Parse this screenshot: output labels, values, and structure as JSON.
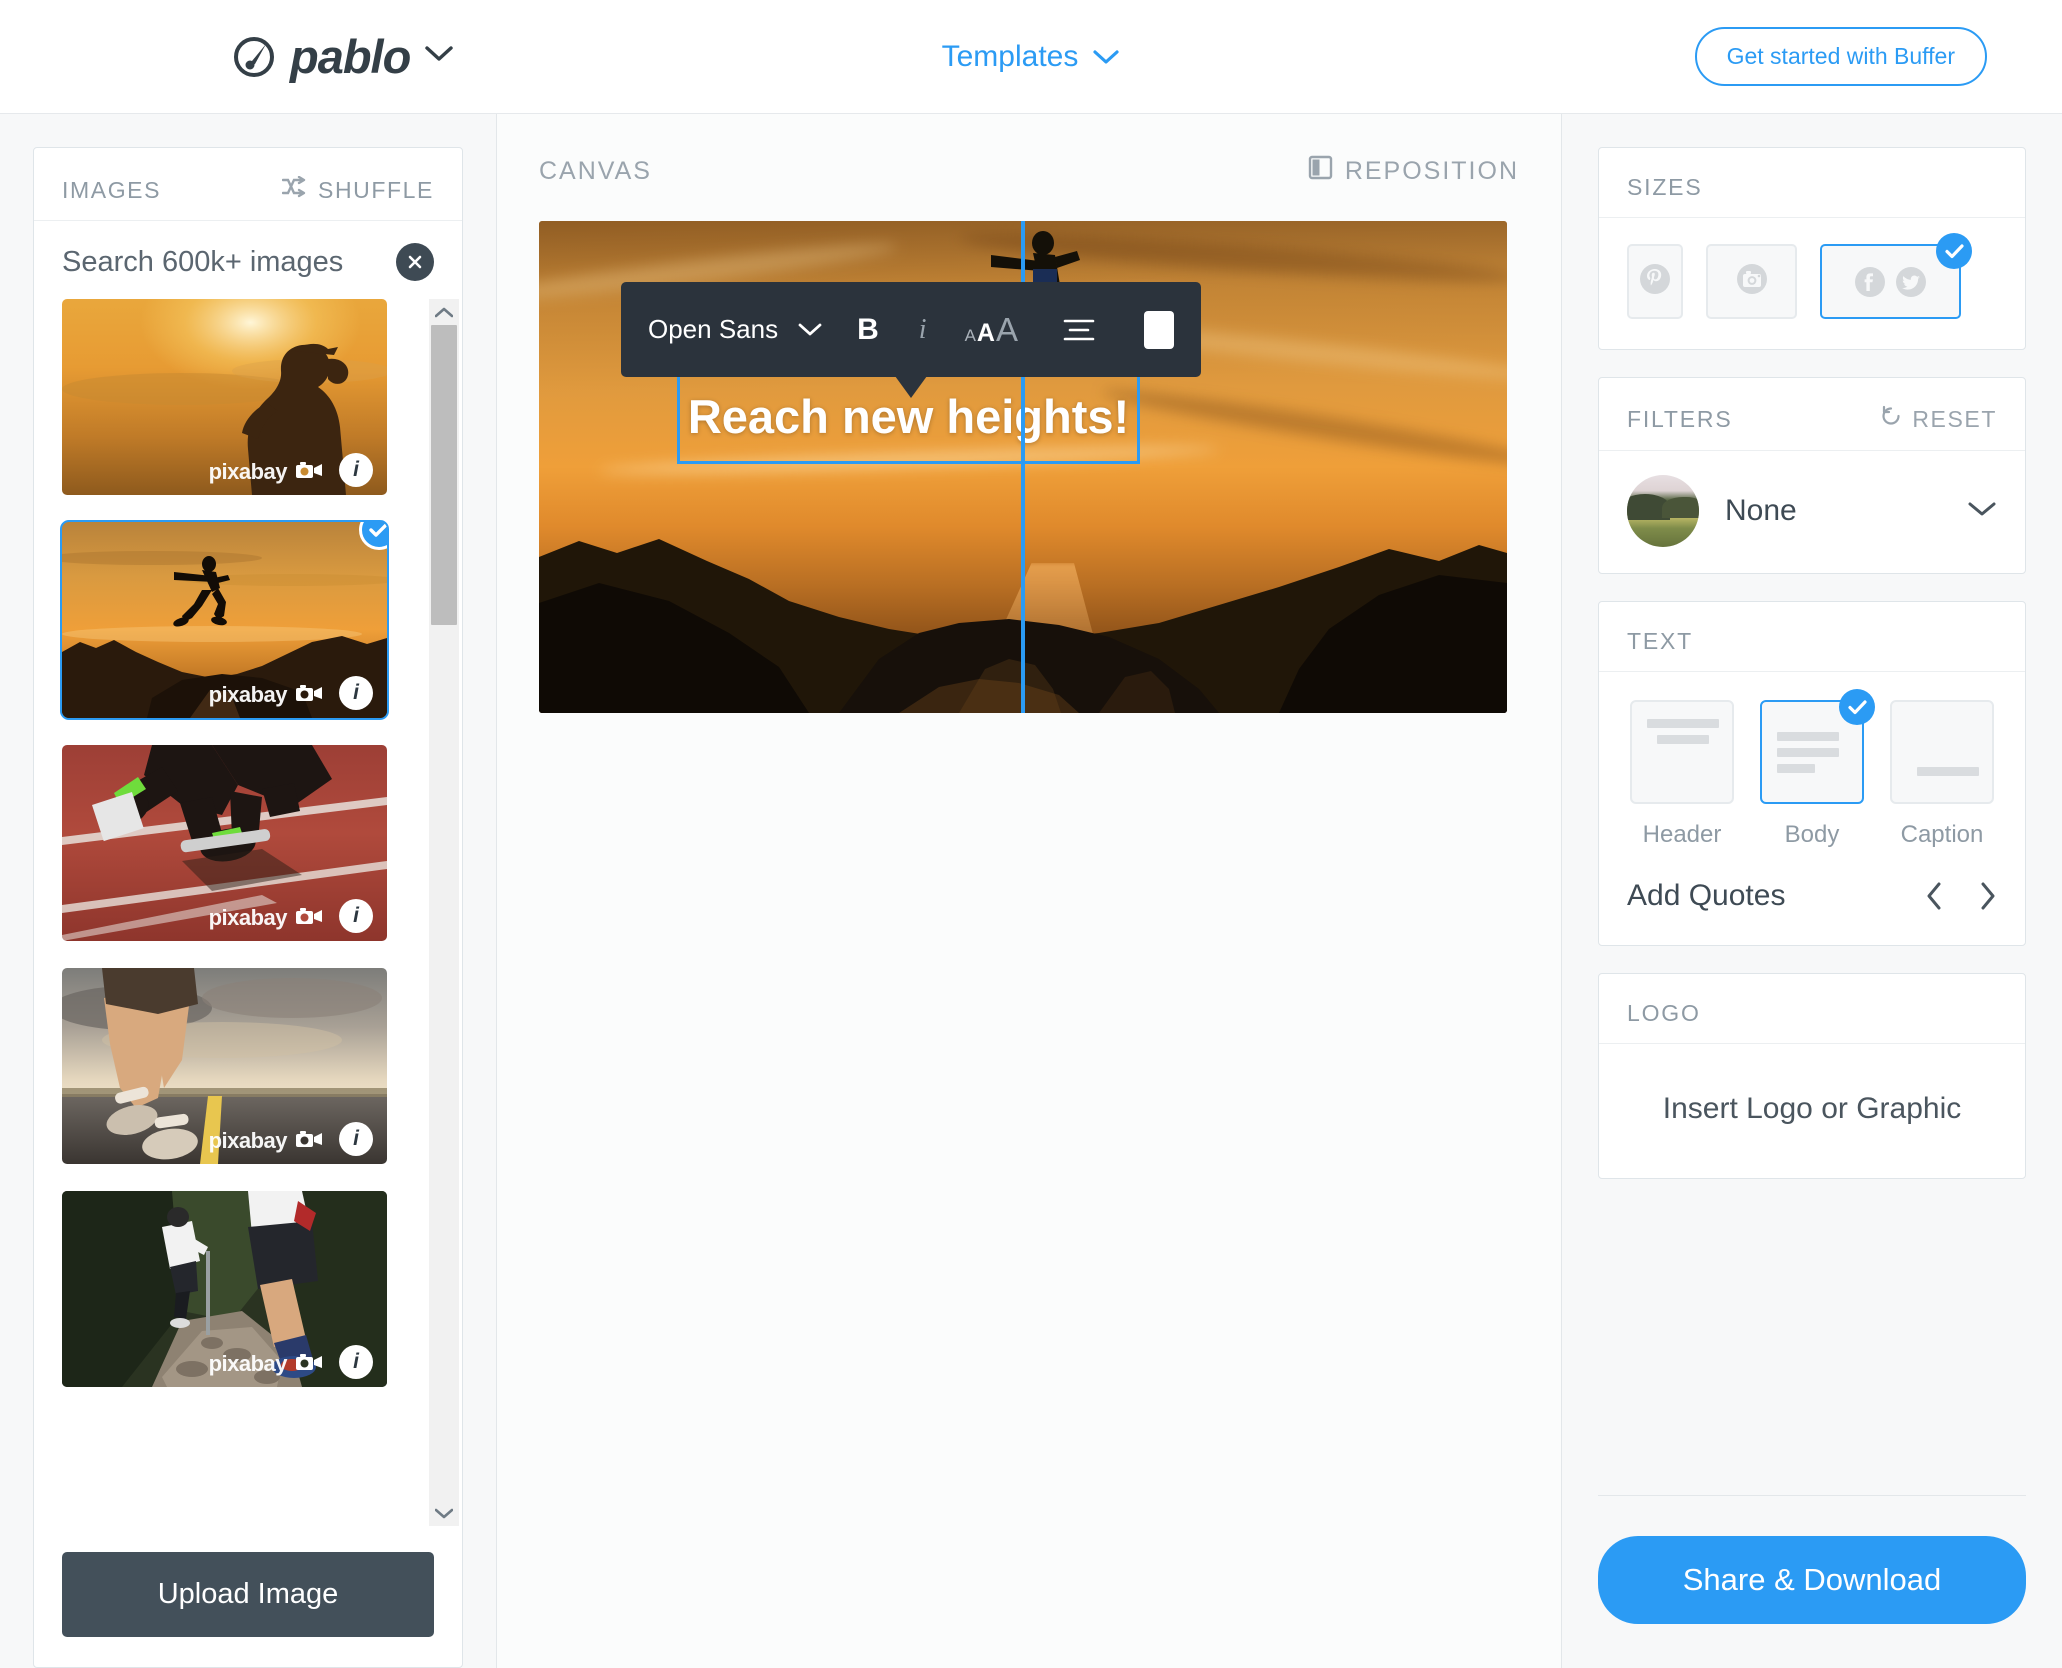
{
  "header": {
    "brand": "pablo",
    "brand_icon": "pablo-brush-circle-icon",
    "brand_chevron": "chevron-down-icon",
    "templates_label": "Templates",
    "templates_chevron": "chevron-down-icon",
    "buffer_button": "Get started with Buffer",
    "accent_blue": "#2b9bf4"
  },
  "images_panel": {
    "title": "IMAGES",
    "shuffle_label": "SHUFFLE",
    "shuffle_icon": "shuffle-icon",
    "search_value": "Search 600k+ images",
    "search_placeholder": "Search 600k+ images",
    "clear_icon": "close-icon",
    "upload_button": "Upload Image",
    "thumbnails": [
      {
        "alt": "Woman running at sunset silhouette",
        "watermark": "pixabay",
        "info": "i",
        "selected": false
      },
      {
        "alt": "Runner leaping over rocky gorge at sunset",
        "watermark": "pixabay",
        "info": "i",
        "selected": true
      },
      {
        "alt": "Sprinter in starting blocks on red track",
        "watermark": "pixabay",
        "info": "i",
        "selected": false
      },
      {
        "alt": "Runner legs on road with yellow line",
        "watermark": "pixabay",
        "info": "i",
        "selected": false
      },
      {
        "alt": "Trail runners on forest path",
        "watermark": "pixabay",
        "info": "i",
        "selected": false
      }
    ]
  },
  "canvas_panel": {
    "title": "CANVAS",
    "reposition_label": "REPOSITION",
    "reposition_icon": "reposition-icon",
    "canvas_text": "Reach new heights!",
    "image_alt": "Runner leaping over rocky gorge at sunset",
    "toolbar": {
      "font_name": "Open Sans",
      "font_chevron": "chevron-down-icon",
      "bold_label": "B",
      "bold_active": true,
      "italic_label": "i",
      "italic_active": false,
      "size_small": "A",
      "size_medium": "A",
      "size_large": "A",
      "align_icon": "align-center-icon",
      "color_swatch": "#ffffff"
    }
  },
  "sizes_panel": {
    "title": "SIZES",
    "options": [
      {
        "name": "Pinterest",
        "icon": "pinterest-icon",
        "selected": false
      },
      {
        "name": "Instagram",
        "icon": "instagram-icon",
        "selected": false
      },
      {
        "name": "Facebook & Twitter",
        "icon": "facebook-twitter-icon",
        "selected": true
      }
    ],
    "check_icon": "check-icon"
  },
  "filters_panel": {
    "title": "FILTERS",
    "reset_label": "RESET",
    "reset_icon": "reset-icon",
    "selected_filter": "None",
    "chevron": "chevron-down-icon",
    "preview_alt": "Landscape filter preview"
  },
  "text_panel": {
    "title": "TEXT",
    "options": [
      {
        "label": "Header",
        "selected": false
      },
      {
        "label": "Body",
        "selected": true
      },
      {
        "label": "Caption",
        "selected": false
      }
    ],
    "check_icon": "check-icon",
    "quotes_label": "Add Quotes",
    "prev_icon": "chevron-left-icon",
    "next_icon": "chevron-right-icon"
  },
  "logo_panel": {
    "title": "LOGO",
    "insert_label": "Insert Logo or Graphic"
  },
  "footer": {
    "share_button": "Share & Download"
  }
}
